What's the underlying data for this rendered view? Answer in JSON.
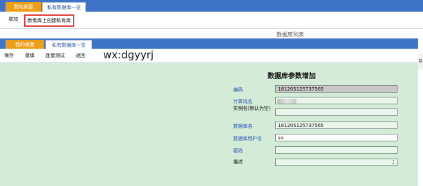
{
  "back": {
    "tabs": {
      "home": "我的桌面",
      "active": "私有数据库一览"
    },
    "toolbar": {
      "add": "增加",
      "create_private": "新看库上创建私有库"
    },
    "hint": "数据库列表",
    "scroll_label": "目"
  },
  "front": {
    "tabs": {
      "home": "我的桌面",
      "active": "私有数据库一览"
    },
    "toolbar": {
      "save": "保存",
      "reset": "重填",
      "test": "连接测试",
      "back": "返回"
    },
    "watermark": "wx:dgyyrj",
    "form": {
      "title": "数据库参数增加",
      "fields": [
        {
          "label": "编码",
          "value": "181205125737565"
        },
        {
          "label": "计算机名",
          "value": ""
        },
        {
          "label": "实例名(默认为空)",
          "value": ""
        },
        {
          "label": "数据库名",
          "value": "181205125737565"
        },
        {
          "label": "数据库用户名",
          "value": "sa"
        },
        {
          "label": "密码",
          "value": ""
        },
        {
          "label": "描述",
          "value": ""
        }
      ]
    }
  }
}
